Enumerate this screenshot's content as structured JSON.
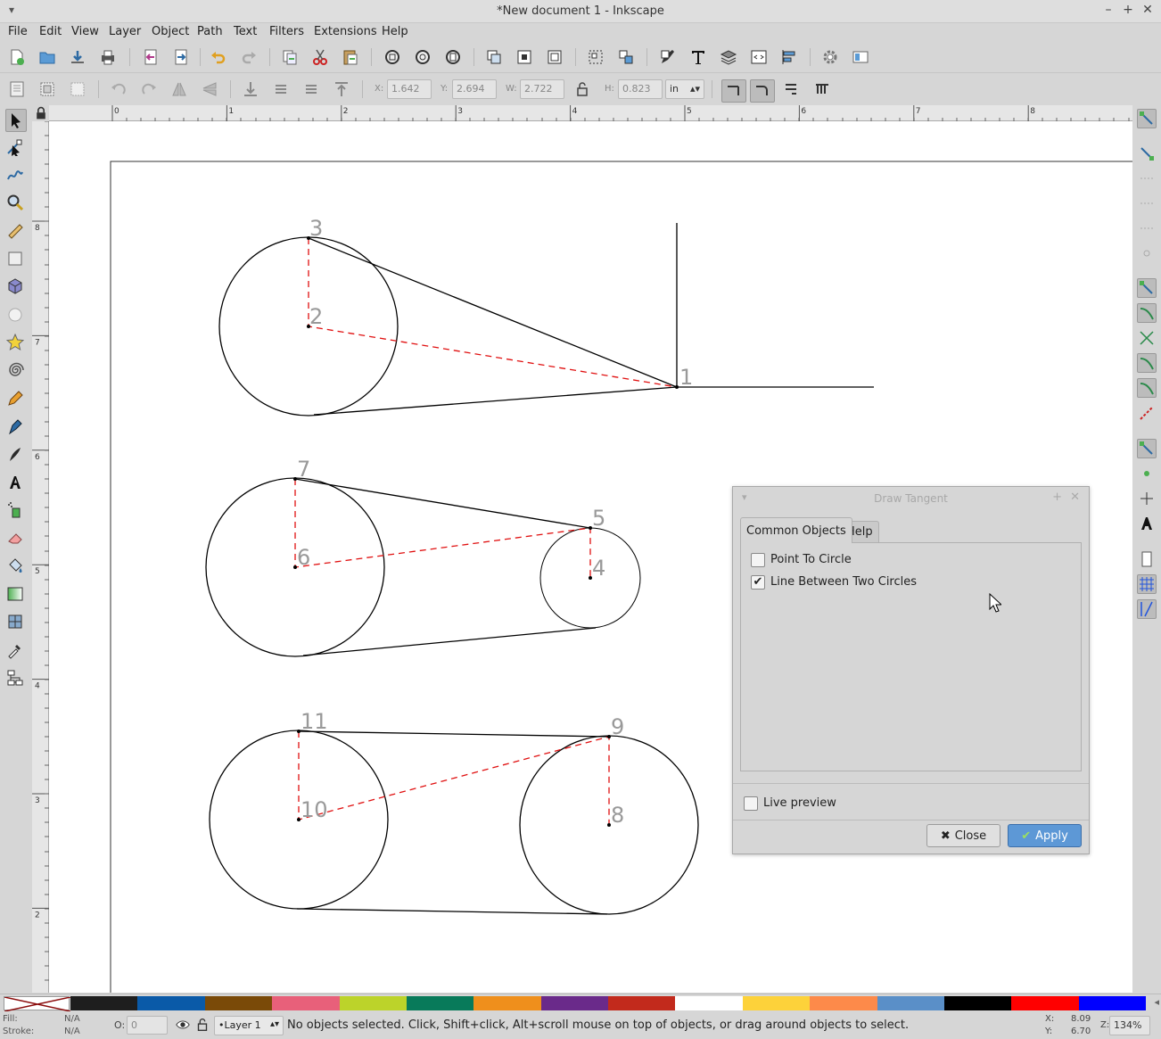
{
  "window": {
    "title": "*New document 1 - Inkscape"
  },
  "menu": [
    "File",
    "Edit",
    "View",
    "Layer",
    "Object",
    "Path",
    "Text",
    "Filters",
    "Extensions",
    "Help"
  ],
  "toolbar2": {
    "x_label": "X:",
    "x_value": "1.642",
    "y_label": "Y:",
    "y_value": "2.694",
    "w_label": "W:",
    "w_value": "2.722",
    "h_label": "H:",
    "h_value": "0.823",
    "unit": "in"
  },
  "ruler": {
    "h_ticks": [
      "0",
      "1",
      "2",
      "3",
      "4",
      "5",
      "6",
      "7",
      "8"
    ],
    "v_ticks": [
      "8",
      "7",
      "6",
      "5",
      "4",
      "3",
      "2"
    ]
  },
  "canvas_labels": {
    "p1": "1",
    "p2": "2",
    "p3": "3",
    "p4": "4",
    "p5": "5",
    "p6": "6",
    "p7": "7",
    "p8": "8",
    "p9": "9",
    "p10": "10",
    "p11": "11"
  },
  "dialog": {
    "title": "Draw Tangent",
    "tabs": [
      "Common Objects",
      "Help"
    ],
    "active_tab": "Common Objects",
    "options": [
      {
        "label": "Point To Circle",
        "checked": false
      },
      {
        "label": "Line Between Two Circles",
        "checked": true
      }
    ],
    "live_preview": {
      "label": "Live preview",
      "checked": false
    },
    "close_label": "Close",
    "apply_label": "Apply"
  },
  "palette": [
    "#1e1e1e",
    "#0a5aa8",
    "#7a4a08",
    "#e8607a",
    "#bcd32a",
    "#087a5a",
    "#ef8f1c",
    "#6a2a8a",
    "#c22a1c",
    "#ffffff",
    "#fdd23a",
    "#fd8a4a",
    "#5a8fc8",
    "#000000",
    "#ff0000",
    "#0000ff"
  ],
  "status": {
    "fill_label": "Fill:",
    "fill_value": "N/A",
    "stroke_label": "Stroke:",
    "stroke_value": "N/A",
    "opacity_label": "O:",
    "opacity_value": "0",
    "layer": "•Layer 1",
    "message": "No objects selected. Click, Shift+click, Alt+scroll mouse on top of objects, or drag around objects to select.",
    "x_label": "X:",
    "x_value": "8.09",
    "y_label": "Y:",
    "y_value": "6.70",
    "zoom_label": "Z:",
    "zoom_value": "134%"
  }
}
